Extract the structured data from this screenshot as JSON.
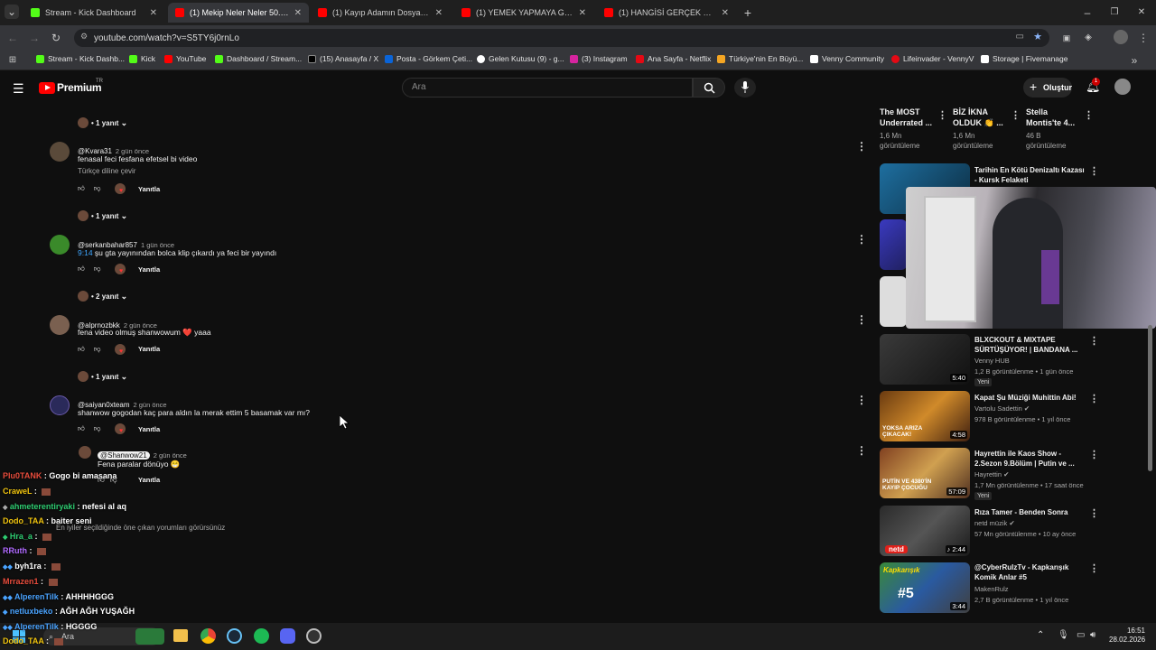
{
  "browser": {
    "tabs": [
      {
        "title": "Stream - Kick Dashboard",
        "color": "#53fc18",
        "active": false
      },
      {
        "title": "(1) Mekip Neler Neler 50.Bölüm",
        "color": "#ff0000",
        "active": true
      },
      {
        "title": "(1) Kayıp Adamın Dosyasında C",
        "color": "#ff0000",
        "active": false
      },
      {
        "title": "(1) YEMEK YAPMAYA GELDİK, D",
        "color": "#ff0000",
        "active": false
      },
      {
        "title": "(1) HANGİSİ GERÇEK STAND-U",
        "color": "#ff0000",
        "active": false
      }
    ],
    "url": "youtube.com/watch?v=S5TY6j0rnLo",
    "bookmarks": [
      {
        "label": "Stream - Kick Dashb...",
        "color": "#53fc18"
      },
      {
        "label": "Kick",
        "color": "#53fc18"
      },
      {
        "label": "YouTube",
        "color": "#ff0000"
      },
      {
        "label": "Dashboard / Stream...",
        "color": "#53fc18"
      },
      {
        "label": "(15) Anasayfa / X",
        "color": "#000000"
      },
      {
        "label": "Posta - Görkem Çeti...",
        "color": "#0a64d8"
      },
      {
        "label": "Gelen Kutusu (9) - g...",
        "color": "#ffffff"
      },
      {
        "label": "(3) Instagram",
        "color": "#d6249f"
      },
      {
        "label": "Ana Sayfa - Netflix",
        "color": "#e50914"
      },
      {
        "label": "Türkiye'nin En Büyü...",
        "color": "#f5a623"
      },
      {
        "label": "Venny Community",
        "color": "#ffffff"
      },
      {
        "label": "Lifeinvader - VennyV",
        "color": "#e50914"
      },
      {
        "label": "Storage | Fivemanage",
        "color": "#ffffff"
      }
    ]
  },
  "youtube": {
    "logo": "Premium",
    "logo_sup": "TR",
    "search_placeholder": "Ara",
    "create_label": "Oluştur",
    "notif_count": "1"
  },
  "comments": [
    {
      "author": "@Kvara31",
      "time": "2 gün önce",
      "text": "fenasal feci fesfana efetsel bi video",
      "translate": "Türkçe diline çevir",
      "reply_label": "Yanıtla",
      "replies": "1 yanıt"
    },
    {
      "author": "@serkanbahar857",
      "time": "1 gün önce",
      "timestamp": "9:14",
      "text": "şu gta yayınından bolca klip çıkardı ya feci bir yayındı",
      "reply_label": "Yanıtla",
      "replies": "2 yanıt"
    },
    {
      "author": "@alprnozbkk",
      "time": "2 gün önce",
      "text": "fena video olmuş shanwowum ❤️ yaaa",
      "reply_label": "Yanıtla",
      "replies": "1 yanıt"
    },
    {
      "author": "@saiyan0xteam",
      "time": "2 gün önce",
      "text": "shanwow gogodan kaç para aldın la merak ettim 5 basamak var mı?",
      "reply_label": "Yanıtla"
    }
  ],
  "top_reply_count": "1 yanıt",
  "reply": {
    "author": "@Shanwow21",
    "time": "2 gün önce",
    "text": "Fena paralar dönüyo 😁",
    "reply_label": "Yanıtla"
  },
  "footer_note": "En iyiler seçildiğinde öne çıkan yorumları görürsünüz",
  "chat": [
    {
      "user": "Plu0TANK",
      "msg": "Gogo bi amasana",
      "color": "#e74c3c"
    },
    {
      "user": "CraweL",
      "msg": "",
      "color": "#f1c40f"
    },
    {
      "user": "ahmeterentiryaki",
      "msg": "nefesi al aq",
      "color": "#2ecc71"
    },
    {
      "user": "Dodo_TAA",
      "msg": "baiter seni",
      "color": "#f1c40f"
    },
    {
      "user": "Hra_a",
      "msg": "",
      "color": "#2ecc71"
    },
    {
      "user": "RRuth",
      "msg": "",
      "color": "#b06aff"
    },
    {
      "user": "byh1ra",
      "msg": "",
      "color": "#ffffff"
    },
    {
      "user": "Mrrazen1",
      "msg": "",
      "color": "#e74c3c"
    },
    {
      "user": "AlperenTilk",
      "msg": "AHHHHGGG",
      "color": "#4aa3ff"
    },
    {
      "user": "netluxbeko",
      "msg": "AĞH AĞH YUŞAĞH",
      "color": "#4aa3ff"
    },
    {
      "user": "AlperenTilk",
      "msg": "HGGGG",
      "color": "#4aa3ff"
    },
    {
      "user": "Dodo_TAA",
      "msg": "",
      "color": "#f1c40f"
    }
  ],
  "shorts": [
    {
      "title": "The MOST Underrated ...",
      "views": "1,6 Mn görüntüleme"
    },
    {
      "title": "BİZ İKNA OLDUK 👏 ...",
      "views": "1,6 Mn görüntüleme"
    },
    {
      "title": "Stella Montis'te 4...",
      "views": "46 B görüntüleme"
    }
  ],
  "videos": [
    {
      "title": "Tarihin En Kötü Denizaltı Kazası - Kursk Felaketi",
      "channel": "",
      "meta": "",
      "duration": "",
      "new": ""
    },
    {
      "title": "BLXCKOUT & MIXTAPE SÜRTÜŞÜYOR! | BANDANA ...",
      "channel": "Venny HUB",
      "meta": "1,2 B görüntülenme • 1 gün önce",
      "duration": "5:40",
      "new": "Yeni"
    },
    {
      "title": "Kapat Şu Müziği Muhittin Abi!",
      "channel": "Vartolu Sadettin",
      "meta": "978 B görüntülenme • 1 yıl önce",
      "duration": "4:58",
      "new": ""
    },
    {
      "title": "Hayrettin ile Kaos Show - 2.Sezon 9.Bölüm | Putin ve ...",
      "channel": "Hayrettin",
      "meta": "1,7 Mn görüntülenme • 17 saat önce",
      "duration": "57:09",
      "new": "Yeni"
    },
    {
      "title": "Rıza Tamer - Benden Sonra",
      "channel": "netd müzik",
      "meta": "57 Mn görüntülenme • 10 ay önce",
      "duration": "2:44",
      "new": ""
    },
    {
      "title": "@CyberRulzTv - Kapkarışık Komik Anlar #5",
      "channel": "MakenRulz",
      "meta": "2,7 B görüntülenme • 1 yıl önce",
      "duration": "3:44",
      "new": ""
    }
  ],
  "thumb_text": {
    "yoksa": "YOKSA ARIZA ÇIKACAK!",
    "putin": "PUTİN VE 4380'İN KAYIP ÇOCUĞU",
    "netd": "netd",
    "kapkarisik": "Kapkarışık",
    "five": "#5"
  },
  "taskbar": {
    "search": "Ara",
    "time": "16:51",
    "date": "28.02.2026"
  }
}
